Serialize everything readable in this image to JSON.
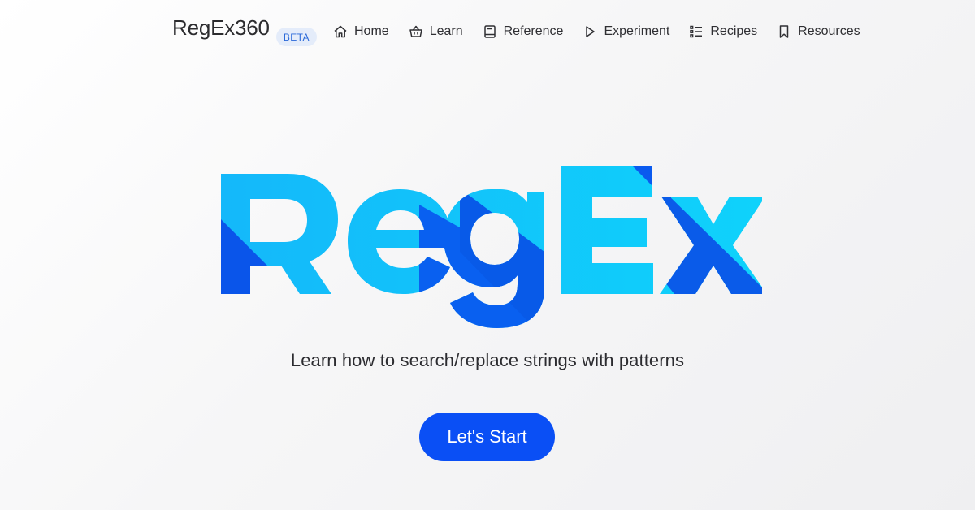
{
  "brand": {
    "name": "RegEx360",
    "badge": "BETA"
  },
  "nav": {
    "items": [
      {
        "label": "Home",
        "icon": "home-icon"
      },
      {
        "label": "Learn",
        "icon": "basket-icon"
      },
      {
        "label": "Reference",
        "icon": "book-icon"
      },
      {
        "label": "Experiment",
        "icon": "play-icon"
      },
      {
        "label": "Recipes",
        "icon": "list-icon"
      },
      {
        "label": "Resources",
        "icon": "bookmark-icon"
      }
    ]
  },
  "hero": {
    "logo_text": "RegEx",
    "tagline": "Learn how to search/replace strings with patterns",
    "cta_label": "Let's Start"
  },
  "colors": {
    "logo_light": "#16c8fb",
    "logo_dark": "#0a55ea",
    "accent": "#0a4ff5",
    "badge_bg": "#e4ecfa",
    "badge_text": "#2867d8"
  }
}
